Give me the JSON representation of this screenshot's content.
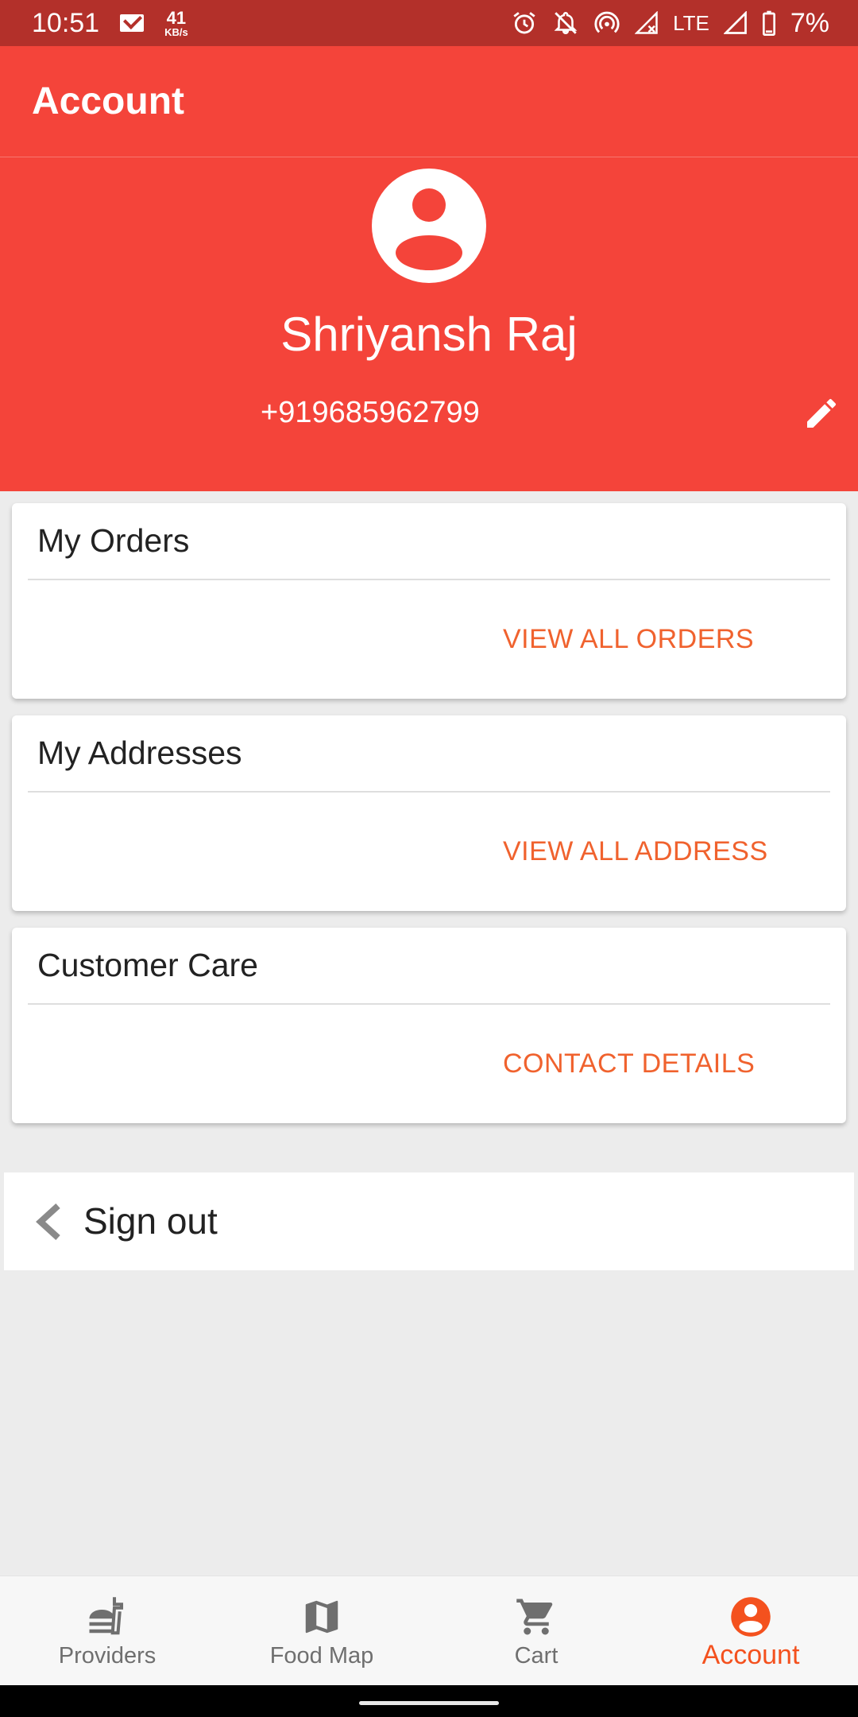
{
  "status_bar": {
    "time": "10:51",
    "speed_value": "41",
    "speed_unit": "KB/s",
    "network": "LTE",
    "battery": "7%"
  },
  "app_bar": {
    "title": "Account"
  },
  "profile": {
    "name": "Shriyansh Raj",
    "phone": "+919685962799"
  },
  "cards": [
    {
      "title": "My Orders",
      "action": "VIEW ALL ORDERS"
    },
    {
      "title": "My Addresses",
      "action": "VIEW ALL ADDRESS"
    },
    {
      "title": "Customer Care",
      "action": "CONTACT DETAILS"
    }
  ],
  "signout": {
    "label": "Sign out"
  },
  "bottom_nav": {
    "items": [
      {
        "label": "Providers",
        "icon": "fastfood-icon"
      },
      {
        "label": "Food Map",
        "icon": "map-icon"
      },
      {
        "label": "Cart",
        "icon": "cart-icon"
      },
      {
        "label": "Account",
        "icon": "account-circle-icon",
        "active": true
      }
    ]
  },
  "colors": {
    "primary": "#f4443a",
    "status_bar": "#b3302a",
    "accent": "#f4511e",
    "action_text": "#f0622e",
    "background": "#ececec"
  }
}
